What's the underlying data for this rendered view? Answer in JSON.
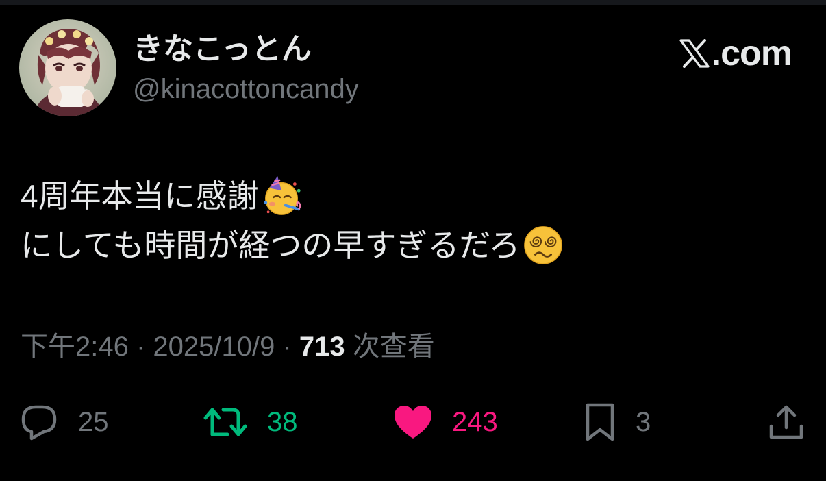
{
  "author": {
    "display_name": "きなこっとん",
    "handle": "@kinacottoncandy"
  },
  "brand": {
    "label": ".com"
  },
  "tweet": {
    "line1": "4周年本当に感謝",
    "line1_emoji": "partying-face",
    "line2": "にしても時間が経つの早すぎるだろ",
    "line2_emoji": "face-with-spiral-eyes"
  },
  "meta": {
    "time": "下午2:46",
    "separator1": " · ",
    "date": "2025/10/9",
    "separator2": " · ",
    "views_count": "713",
    "views_label": " 次查看"
  },
  "actions": {
    "reply_count": "25",
    "retweet_count": "38",
    "like_count": "243",
    "bookmark_count": "3"
  },
  "colors": {
    "background": "#000000",
    "text_primary": "#e7e9ea",
    "text_secondary": "#71767b",
    "retweet_active": "#00ba7c",
    "like_active": "#f91880"
  }
}
